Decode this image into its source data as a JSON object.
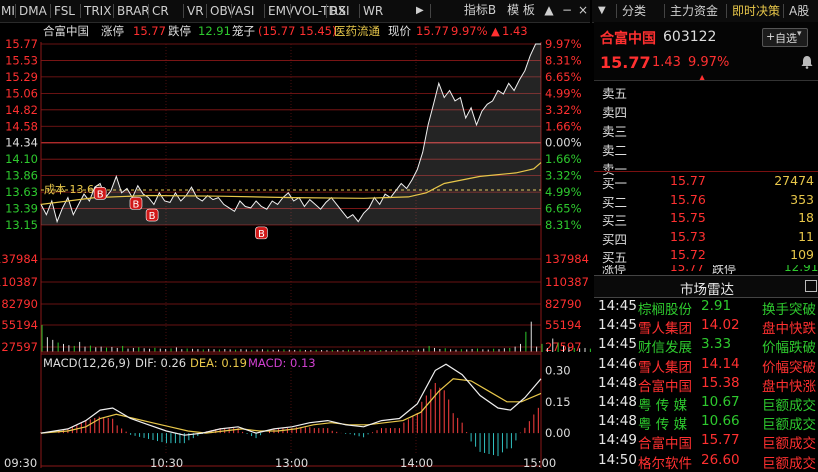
{
  "toolbar": {
    "indicators": [
      "MI",
      "DMA",
      "FSL",
      "TRIX",
      "BRAR",
      "CR",
      "VR",
      "OBV",
      "ASI",
      "EMV",
      "VOL-TDX",
      "RSI",
      "WR"
    ],
    "more_arrow": "▶",
    "indicator_btn": "指标B",
    "template_btn": "模 板",
    "up_icon": "▲",
    "minimize_icon": "−",
    "close_icon": "×"
  },
  "right_tabs": [
    "分类",
    "主力资金",
    "即时决策",
    "A股"
  ],
  "right_tabs_active": 2,
  "right_tabs_chevron": "▼",
  "info_bar": {
    "name": "合富中国",
    "limit_up_label": "涨停",
    "limit_up": "15.77",
    "limit_down_label": "跌停",
    "limit_down": "12.91",
    "cage_label": "笼子",
    "cage": "(15.77 15.45)",
    "sector": "医药流通",
    "now_label": "现价",
    "now": "15.77",
    "pct": "9.97%",
    "up_arrow": "▲",
    "change": "1.43"
  },
  "price_axis_left": [
    "15.77",
    "15.53",
    "15.29",
    "15.06",
    "14.82",
    "14.58",
    "14.34",
    "14.10",
    "13.86",
    "13.63",
    "13.39",
    "13.15"
  ],
  "pct_axis_right": [
    "9.97%",
    "8.31%",
    "6.65%",
    "4.99%",
    "3.32%",
    "1.66%",
    "0.00%",
    "1.66%",
    "3.32%",
    "4.99%",
    "6.65%",
    "8.31%"
  ],
  "volume_axis": [
    "137984",
    "110387",
    "82790",
    "55194",
    "27597"
  ],
  "macd_axis": [
    "0.30",
    "0.15",
    "0.00"
  ],
  "macd_legend": {
    "title": "MACD(12,26,9)",
    "dif": "DIF: 0.26",
    "dea": "DEA: 0.19",
    "macd": "MACD: 0.13"
  },
  "time_axis": [
    "09:30",
    "10:30",
    "13:00",
    "14:00",
    "15:00"
  ],
  "cost_label": "成本 13.66",
  "buy_marker": "B",
  "quote": {
    "name": "合富中国",
    "code": "603122",
    "self_select": "自选",
    "price": "15.77",
    "change": "1.43",
    "pct": "9.97%",
    "bell_icon": "bell",
    "collapse_icon": "▲",
    "sells": [
      {
        "label": "卖五",
        "price": "",
        "vol": ""
      },
      {
        "label": "卖四",
        "price": "",
        "vol": ""
      },
      {
        "label": "卖三",
        "price": "",
        "vol": ""
      },
      {
        "label": "卖二",
        "price": "",
        "vol": ""
      },
      {
        "label": "卖一",
        "price": "",
        "vol": ""
      }
    ],
    "buys": [
      {
        "label": "买一",
        "price": "15.77",
        "vol": "27474"
      },
      {
        "label": "买二",
        "price": "15.76",
        "vol": "353"
      },
      {
        "label": "买三",
        "price": "15.75",
        "vol": "18"
      },
      {
        "label": "买四",
        "price": "15.73",
        "vol": "11"
      },
      {
        "label": "买五",
        "price": "15.72",
        "vol": "109"
      }
    ],
    "limit_row": {
      "l1": "涨停",
      "v1": "15.77",
      "l2": "跌停",
      "v2": "12.91"
    }
  },
  "radar": {
    "title": "市场雷达",
    "expand_icon": "▢",
    "items": [
      {
        "time": "14:45",
        "name": "棕榈股份",
        "price": "2.91",
        "event": "换手突破",
        "up": false
      },
      {
        "time": "14:45",
        "name": "雪人集团",
        "price": "14.02",
        "event": "盘中快跌",
        "up": true
      },
      {
        "time": "14:45",
        "name": "财信发展",
        "price": "3.33",
        "event": "价幅跌破",
        "up": false
      },
      {
        "time": "14:46",
        "name": "雪人集团",
        "price": "14.14",
        "event": "价幅突破",
        "up": true
      },
      {
        "time": "14:48",
        "name": "合富中国",
        "price": "15.38",
        "event": "盘中快涨",
        "up": true
      },
      {
        "time": "14:48",
        "name": "粤 传 媒",
        "price": "10.67",
        "event": "巨额成交",
        "up": false
      },
      {
        "time": "14:48",
        "name": "粤 传 媒",
        "price": "10.66",
        "event": "巨额成交",
        "up": false
      },
      {
        "time": "14:49",
        "name": "合富中国",
        "price": "15.77",
        "event": "巨额成交",
        "up": true
      },
      {
        "time": "14:50",
        "name": "格尔软件",
        "price": "26.60",
        "event": "巨额成交",
        "up": true
      }
    ]
  },
  "chart_data": {
    "type": "line",
    "x_range": [
      "09:30",
      "15:00"
    ],
    "prev_close": 14.34,
    "ylim": [
      12.91,
      15.77
    ],
    "price": [
      [
        0,
        13.45
      ],
      [
        3,
        13.3
      ],
      [
        6,
        13.5
      ],
      [
        9,
        13.2
      ],
      [
        12,
        13.4
      ],
      [
        15,
        13.55
      ],
      [
        18,
        13.3
      ],
      [
        21,
        13.45
      ],
      [
        24,
        13.6
      ],
      [
        27,
        13.5
      ],
      [
        30,
        13.7
      ],
      [
        33,
        13.75
      ],
      [
        36,
        13.55
      ],
      [
        39,
        13.65
      ],
      [
        42,
        13.85
      ],
      [
        45,
        13.62
      ],
      [
        48,
        13.68
      ],
      [
        51,
        13.55
      ],
      [
        54,
        13.72
      ],
      [
        57,
        13.6
      ],
      [
        60,
        13.55
      ],
      [
        63,
        13.45
      ],
      [
        66,
        13.62
      ],
      [
        69,
        13.5
      ],
      [
        72,
        13.48
      ],
      [
        75,
        13.62
      ],
      [
        78,
        13.5
      ],
      [
        81,
        13.58
      ],
      [
        84,
        13.7
      ],
      [
        87,
        13.55
      ],
      [
        90,
        13.5
      ],
      [
        93,
        13.58
      ],
      [
        96,
        13.52
      ],
      [
        99,
        13.55
      ],
      [
        102,
        13.45
      ],
      [
        105,
        13.4
      ],
      [
        108,
        13.35
      ],
      [
        111,
        13.5
      ],
      [
        114,
        13.42
      ],
      [
        117,
        13.4
      ],
      [
        120,
        13.5
      ],
      [
        123,
        13.42
      ],
      [
        126,
        13.38
      ],
      [
        129,
        13.5
      ],
      [
        132,
        13.45
      ],
      [
        135,
        13.55
      ],
      [
        138,
        13.62
      ],
      [
        141,
        13.5
      ],
      [
        144,
        13.55
      ],
      [
        147,
        13.42
      ],
      [
        150,
        13.52
      ],
      [
        153,
        13.45
      ],
      [
        156,
        13.38
      ],
      [
        159,
        13.48
      ],
      [
        162,
        13.55
      ],
      [
        165,
        13.45
      ],
      [
        168,
        13.35
      ],
      [
        171,
        13.25
      ],
      [
        174,
        13.3
      ],
      [
        177,
        13.2
      ],
      [
        180,
        13.32
      ],
      [
        183,
        13.4
      ],
      [
        186,
        13.55
      ],
      [
        189,
        13.45
      ],
      [
        192,
        13.6
      ],
      [
        195,
        13.55
      ],
      [
        198,
        13.65
      ],
      [
        201,
        13.75
      ],
      [
        204,
        13.68
      ],
      [
        207,
        13.8
      ],
      [
        210,
        13.95
      ],
      [
        213,
        14.2
      ],
      [
        216,
        14.6
      ],
      [
        219,
        14.9
      ],
      [
        222,
        15.2
      ],
      [
        225,
        15.0
      ],
      [
        228,
        15.1
      ],
      [
        231,
        14.95
      ],
      [
        234,
        15.0
      ],
      [
        237,
        14.7
      ],
      [
        240,
        14.85
      ],
      [
        243,
        14.6
      ],
      [
        246,
        14.8
      ],
      [
        249,
        14.9
      ],
      [
        252,
        14.95
      ],
      [
        255,
        15.1
      ],
      [
        258,
        15.05
      ],
      [
        261,
        15.2
      ],
      [
        264,
        15.1
      ],
      [
        267,
        15.25
      ],
      [
        270,
        15.38
      ],
      [
        273,
        15.6
      ],
      [
        276,
        15.77
      ],
      [
        279,
        15.77
      ]
    ],
    "avg_price": [
      [
        0,
        13.45
      ],
      [
        30,
        13.55
      ],
      [
        60,
        13.58
      ],
      [
        100,
        13.57
      ],
      [
        140,
        13.55
      ],
      [
        180,
        13.54
      ],
      [
        205,
        13.56
      ],
      [
        215,
        13.62
      ],
      [
        225,
        13.75
      ],
      [
        245,
        13.85
      ],
      [
        265,
        13.9
      ],
      [
        275,
        13.96
      ],
      [
        279,
        14.05
      ]
    ],
    "cost": 13.66,
    "buy_markers": [
      [
        33,
        13.78
      ],
      [
        53,
        13.64
      ],
      [
        62,
        13.47
      ],
      [
        123,
        13.21
      ]
    ],
    "volume_ylim": [
      0,
      137984
    ],
    "volume_step": 3,
    "volume": [
      40000,
      22000,
      18000,
      14000,
      12000,
      10000,
      9000,
      15000,
      8000,
      9500,
      7000,
      8000,
      6500,
      7500,
      6000,
      9000,
      5000,
      6000,
      7000,
      5500,
      4800,
      6200,
      5000,
      4500,
      5200,
      6800,
      4200,
      5000,
      4700,
      4300,
      3800,
      4600,
      4100,
      3700,
      4400,
      3900,
      3500,
      4200,
      3800,
      3300,
      3600,
      4000,
      3500,
      3200,
      3400,
      3800,
      3300,
      3100,
      3600,
      3000,
      2800,
      3200,
      3000,
      2700,
      3100,
      2900,
      2600,
      3300,
      2900,
      2500,
      3000,
      2700,
      2600,
      3000,
      2800,
      2500,
      2900,
      2700,
      2400,
      2600,
      3500,
      5000,
      9000,
      6000,
      4500,
      5500,
      4000,
      3500,
      4200,
      3800,
      4500,
      5000,
      4000,
      3600,
      4800,
      4200,
      5500,
      6000,
      8000,
      12000,
      30000,
      45000,
      8000,
      12000,
      6000,
      20000,
      14000,
      9000,
      7000,
      6000,
      5500,
      6000,
      5000,
      4500,
      5200,
      6000,
      7000,
      8000,
      9000,
      12000,
      40000
    ],
    "macd": {
      "ylim": [
        -0.1,
        0.35
      ],
      "dif": [
        [
          0,
          0.0
        ],
        [
          15,
          0.02
        ],
        [
          25,
          0.06
        ],
        [
          33,
          0.11
        ],
        [
          40,
          0.12
        ],
        [
          50,
          0.07
        ],
        [
          60,
          0.04
        ],
        [
          70,
          0.01
        ],
        [
          80,
          -0.01
        ],
        [
          90,
          0.0
        ],
        [
          100,
          0.02
        ],
        [
          110,
          0.03
        ],
        [
          120,
          0.0
        ],
        [
          130,
          0.02
        ],
        [
          140,
          0.03
        ],
        [
          150,
          0.05
        ],
        [
          160,
          0.06
        ],
        [
          170,
          0.04
        ],
        [
          180,
          0.03
        ],
        [
          190,
          0.06
        ],
        [
          200,
          0.07
        ],
        [
          210,
          0.14
        ],
        [
          220,
          0.3
        ],
        [
          226,
          0.33
        ],
        [
          235,
          0.28
        ],
        [
          245,
          0.18
        ],
        [
          255,
          0.12
        ],
        [
          262,
          0.11
        ],
        [
          270,
          0.17
        ],
        [
          279,
          0.26
        ]
      ],
      "dea": [
        [
          0,
          0.0
        ],
        [
          15,
          0.01
        ],
        [
          25,
          0.03
        ],
        [
          33,
          0.07
        ],
        [
          42,
          0.09
        ],
        [
          52,
          0.07
        ],
        [
          62,
          0.05
        ],
        [
          72,
          0.03
        ],
        [
          82,
          0.01
        ],
        [
          92,
          0.0
        ],
        [
          102,
          0.01
        ],
        [
          112,
          0.02
        ],
        [
          122,
          0.01
        ],
        [
          132,
          0.01
        ],
        [
          142,
          0.02
        ],
        [
          152,
          0.04
        ],
        [
          162,
          0.05
        ],
        [
          172,
          0.04
        ],
        [
          182,
          0.04
        ],
        [
          192,
          0.05
        ],
        [
          202,
          0.06
        ],
        [
          212,
          0.1
        ],
        [
          222,
          0.2
        ],
        [
          230,
          0.26
        ],
        [
          240,
          0.25
        ],
        [
          250,
          0.2
        ],
        [
          260,
          0.15
        ],
        [
          268,
          0.15
        ],
        [
          279,
          0.19
        ]
      ]
    }
  }
}
